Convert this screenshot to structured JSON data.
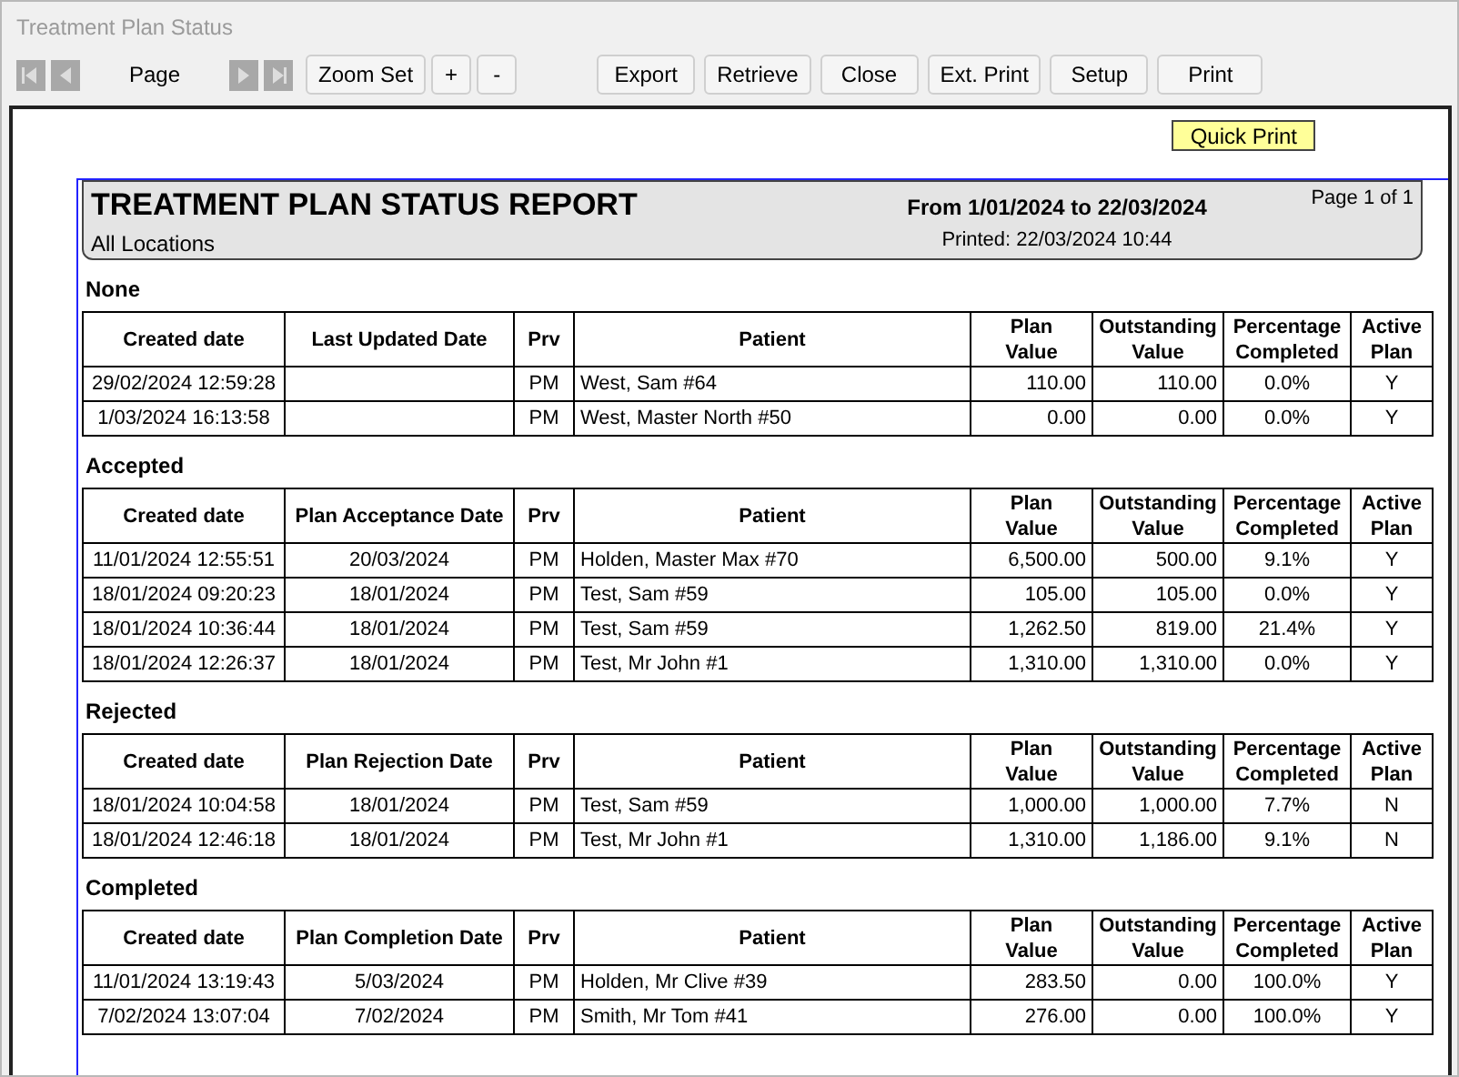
{
  "window": {
    "title": "Treatment Plan Status"
  },
  "toolbar": {
    "page_label": "Page",
    "buttons": [
      "Zoom Set",
      "+",
      "-"
    ],
    "actions": [
      "Export",
      "Retrieve",
      "Close",
      "Ext. Print",
      "Setup",
      "Print"
    ]
  },
  "quick_print": "Quick Print",
  "report": {
    "title": "TREATMENT PLAN STATUS REPORT",
    "locations": "All Locations",
    "range": "From 1/01/2024 to 22/03/2024",
    "printed": "Printed: 22/03/2024 10:44",
    "page": "Page 1 of 1",
    "sections": [
      {
        "title": "None",
        "columns": [
          "Created date",
          "Last Updated Date",
          "Prv",
          "Patient",
          "Plan Value",
          "Outstanding Value",
          "Percentage Completed",
          "Active Plan"
        ],
        "rows": [
          [
            "29/02/2024 12:59:28",
            "",
            "PM",
            "West, Sam #64",
            "110.00",
            "110.00",
            "0.0%",
            "Y"
          ],
          [
            "1/03/2024 16:13:58",
            "",
            "PM",
            "West, Master North #50",
            "0.00",
            "0.00",
            "0.0%",
            "Y"
          ]
        ]
      },
      {
        "title": "Accepted",
        "columns": [
          "Created date",
          "Plan Acceptance Date",
          "Prv",
          "Patient",
          "Plan Value",
          "Outstanding Value",
          "Percentage Completed",
          "Active Plan"
        ],
        "rows": [
          [
            "11/01/2024 12:55:51",
            "20/03/2024",
            "PM",
            "Holden, Master Max #70",
            "6,500.00",
            "500.00",
            "9.1%",
            "Y"
          ],
          [
            "18/01/2024 09:20:23",
            "18/01/2024",
            "PM",
            "Test, Sam #59",
            "105.00",
            "105.00",
            "0.0%",
            "Y"
          ],
          [
            "18/01/2024 10:36:44",
            "18/01/2024",
            "PM",
            "Test, Sam #59",
            "1,262.50",
            "819.00",
            "21.4%",
            "Y"
          ],
          [
            "18/01/2024 12:26:37",
            "18/01/2024",
            "PM",
            "Test, Mr John #1",
            "1,310.00",
            "1,310.00",
            "0.0%",
            "Y"
          ]
        ]
      },
      {
        "title": "Rejected",
        "columns": [
          "Created date",
          "Plan Rejection Date",
          "Prv",
          "Patient",
          "Plan Value",
          "Outstanding Value",
          "Percentage Completed",
          "Active Plan"
        ],
        "rows": [
          [
            "18/01/2024 10:04:58",
            "18/01/2024",
            "PM",
            "Test, Sam #59",
            "1,000.00",
            "1,000.00",
            "7.7%",
            "N"
          ],
          [
            "18/01/2024 12:46:18",
            "18/01/2024",
            "PM",
            "Test, Mr John #1",
            "1,310.00",
            "1,186.00",
            "9.1%",
            "N"
          ]
        ]
      },
      {
        "title": "Completed",
        "columns": [
          "Created date",
          "Plan Completion Date",
          "Prv",
          "Patient",
          "Plan Value",
          "Outstanding Value",
          "Percentage Completed",
          "Active Plan"
        ],
        "rows": [
          [
            "11/01/2024 13:19:43",
            "5/03/2024",
            "PM",
            "Holden, Mr Clive #39",
            "283.50",
            "0.00",
            "100.0%",
            "Y"
          ],
          [
            "7/02/2024 13:07:04",
            "7/02/2024",
            "PM",
            "Smith, Mr Tom #41",
            "276.00",
            "0.00",
            "100.0%",
            "Y"
          ]
        ]
      }
    ]
  }
}
